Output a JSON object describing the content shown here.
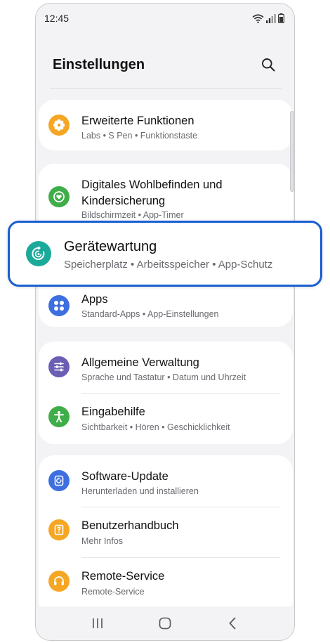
{
  "status_bar": {
    "time": "12:45"
  },
  "header": {
    "title": "Einstellungen"
  },
  "rows": {
    "advanced": {
      "title": "Erweiterte Funktionen",
      "subtitle": "Labs • S Pen • Funktionstaste",
      "icon": "gear-icon",
      "color": "#f5a623"
    },
    "wellbeing": {
      "title_line1": "Digitales Wohlbefinden und",
      "title_line2": "Kindersicherung",
      "subtitle": "Bildschirmzeit • App-Timer",
      "icon": "heart-icon",
      "color": "#3fae49"
    },
    "apps": {
      "title": "Apps",
      "subtitle": "Standard-Apps • App-Einstellungen",
      "icon": "apps-grid-icon",
      "color": "#3d6fe0"
    },
    "general": {
      "title": "Allgemeine Verwaltung",
      "subtitle": "Sprache und Tastatur • Datum und Uhrzeit",
      "icon": "sliders-icon",
      "color": "#6a5fb5"
    },
    "accessibility": {
      "title": "Eingabehilfe",
      "subtitle": "Sichtbarkeit • Hören • Geschicklichkeit",
      "icon": "accessibility-icon",
      "color": "#3fae49"
    },
    "software_update": {
      "title": "Software-Update",
      "subtitle": "Herunterladen und installieren",
      "icon": "update-icon",
      "color": "#3d6fe0"
    },
    "manual": {
      "title": "Benutzerhandbuch",
      "subtitle": "Mehr Infos",
      "icon": "book-question-icon",
      "color": "#f5a623"
    },
    "remote": {
      "title": "Remote-Service",
      "subtitle": "Remote-Service",
      "icon": "headset-icon",
      "color": "#f5a623"
    }
  },
  "highlight": {
    "title": "Gerätewartung",
    "subtitle": "Speicherplatz • Arbeitsspeicher • App-Schutz",
    "icon": "device-care-icon",
    "color": "#1ba99a",
    "border_color": "#1a5fd0"
  },
  "nav": {
    "recents": "recents-icon",
    "home": "home-icon",
    "back": "back-icon"
  }
}
